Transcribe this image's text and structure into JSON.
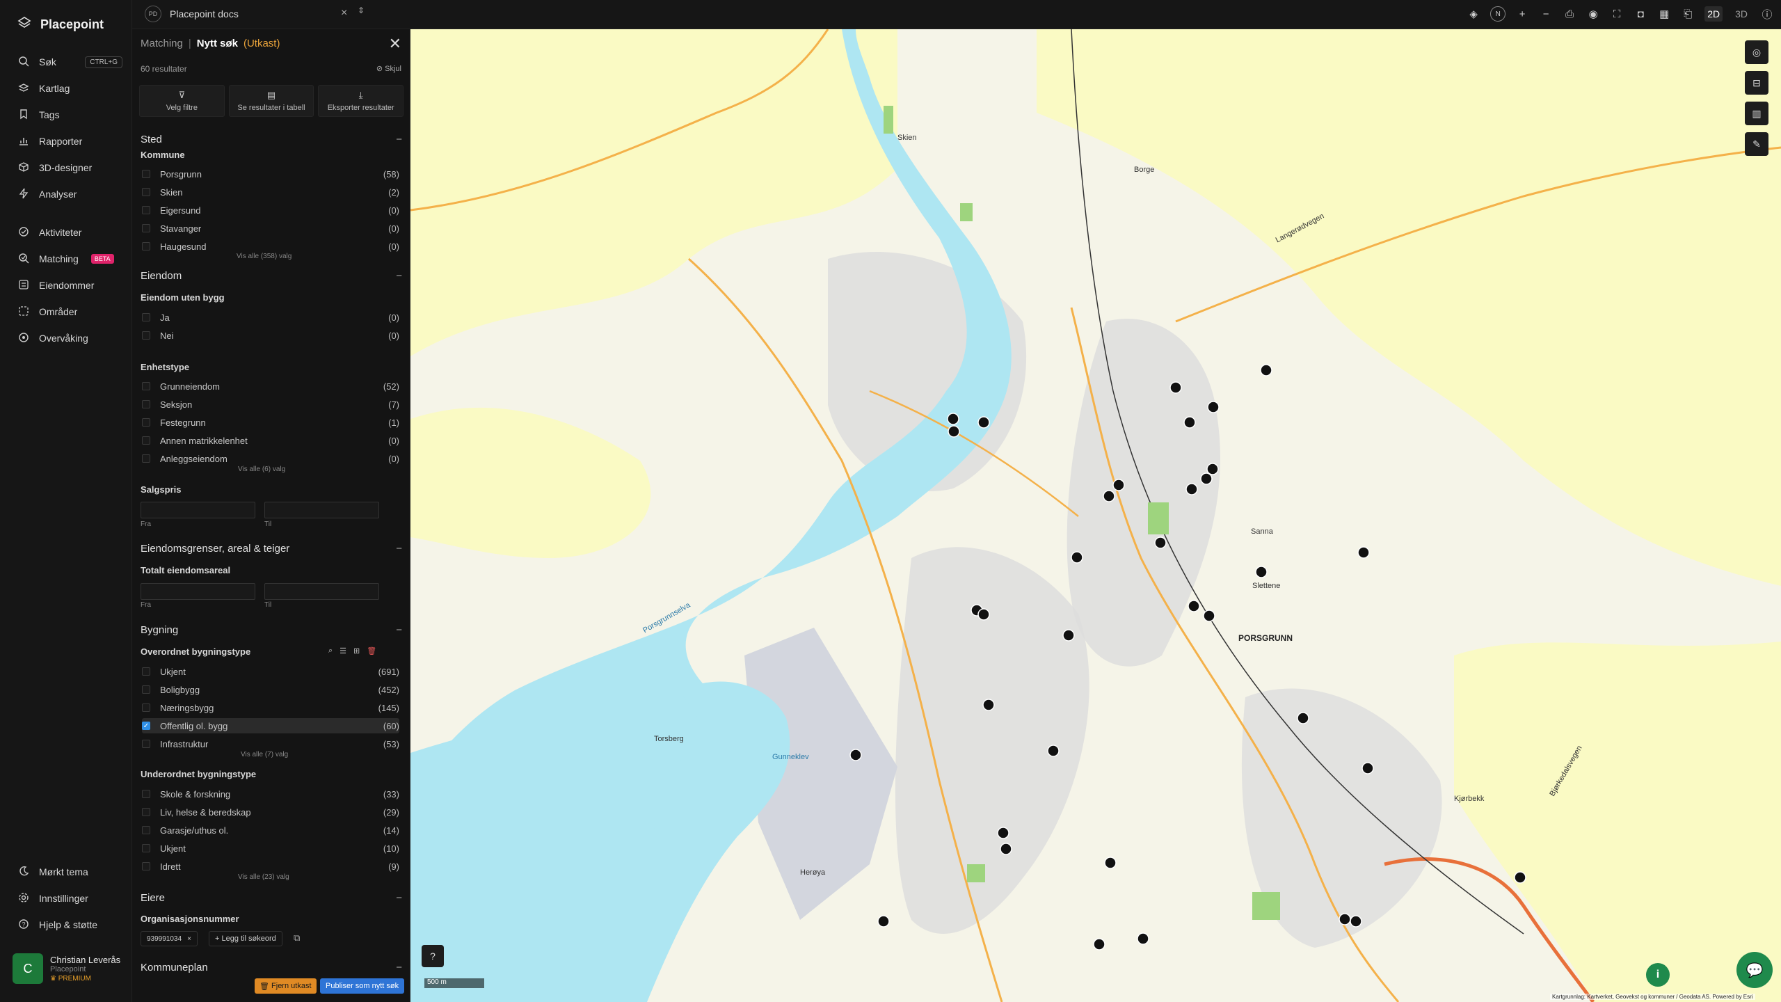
{
  "app": {
    "name": "Placepoint"
  },
  "nav": {
    "items": [
      {
        "label": "Søk",
        "shortcut": "CTRL+G",
        "icon": "search-icon"
      },
      {
        "label": "Kartlag",
        "icon": "layers-icon"
      },
      {
        "label": "Tags",
        "icon": "bookmark-icon"
      },
      {
        "label": "Rapporter",
        "icon": "chart-icon"
      },
      {
        "label": "3D-designer",
        "icon": "cube-icon"
      },
      {
        "label": "Analyser",
        "icon": "bolt-icon"
      },
      {
        "label": "Aktiviteter",
        "icon": "activity-icon"
      },
      {
        "label": "Matching",
        "badge": "BETA",
        "icon": "matching-icon"
      },
      {
        "label": "Eiendommer",
        "icon": "list-icon"
      },
      {
        "label": "Områder",
        "icon": "area-icon"
      },
      {
        "label": "Overvåking",
        "icon": "monitor-icon"
      }
    ],
    "bottom": [
      {
        "label": "Mørkt tema",
        "icon": "moon-icon"
      },
      {
        "label": "Innstillinger",
        "icon": "gear-icon"
      },
      {
        "label": "Hjelp & støtte",
        "icon": "help-icon"
      }
    ]
  },
  "user": {
    "initial": "C",
    "name": "Christian Leverås",
    "org": "Placepoint",
    "plan": "PREMIUM"
  },
  "workspace": {
    "badge": "PD",
    "name": "Placepoint docs"
  },
  "toolbar": {
    "compass": "N",
    "view2d": "2D",
    "view3d": "3D"
  },
  "panel": {
    "crumb": "Matching",
    "title": "Nytt søk",
    "status": "(Utkast)",
    "count": "60 resultater",
    "hide": "Skjul",
    "actions": [
      "Velg filtre",
      "Se resultater i tabell",
      "Eksporter resultater"
    ],
    "sted": {
      "title": "Sted",
      "kommune_label": "Kommune",
      "kommune": [
        {
          "label": "Porsgrunn",
          "count": "(58)"
        },
        {
          "label": "Skien",
          "count": "(2)"
        },
        {
          "label": "Eigersund",
          "count": "(0)"
        },
        {
          "label": "Stavanger",
          "count": "(0)"
        },
        {
          "label": "Haugesund",
          "count": "(0)"
        }
      ],
      "more": "Vis alle (358) valg"
    },
    "eiendom": {
      "title": "Eiendom",
      "uten_bygg_label": "Eiendom uten bygg",
      "uten_bygg": [
        {
          "label": "Ja",
          "count": "(0)"
        },
        {
          "label": "Nei",
          "count": "(0)"
        }
      ],
      "enhetstype_label": "Enhetstype",
      "enhetstype": [
        {
          "label": "Grunneiendom",
          "count": "(52)"
        },
        {
          "label": "Seksjon",
          "count": "(7)"
        },
        {
          "label": "Festegrunn",
          "count": "(1)"
        },
        {
          "label": "Annen matrikkelenhet",
          "count": "(0)"
        },
        {
          "label": "Anleggseiendom",
          "count": "(0)"
        }
      ],
      "more": "Vis alle (6) valg",
      "salgspris_label": "Salgspris",
      "from": "Fra",
      "to": "Til"
    },
    "grenser": {
      "title": "Eiendomsgrenser, areal & teiger",
      "areal_label": "Totalt eiendomsareal",
      "from": "Fra",
      "to": "Til"
    },
    "bygning": {
      "title": "Bygning",
      "overordnet_label": "Overordnet bygningstype",
      "overordnet": [
        {
          "label": "Ukjent",
          "count": "(691)"
        },
        {
          "label": "Boligbygg",
          "count": "(452)"
        },
        {
          "label": "Næringsbygg",
          "count": "(145)"
        },
        {
          "label": "Offentlig ol. bygg",
          "count": "(60)",
          "selected": true
        },
        {
          "label": "Infrastruktur",
          "count": "(53)"
        }
      ],
      "more1": "Vis alle (7) valg",
      "underordnet_label": "Underordnet bygningstype",
      "underordnet": [
        {
          "label": "Skole & forskning",
          "count": "(33)"
        },
        {
          "label": "Liv, helse & beredskap",
          "count": "(29)"
        },
        {
          "label": "Garasje/uthus ol.",
          "count": "(14)"
        },
        {
          "label": "Ukjent",
          "count": "(10)"
        },
        {
          "label": "Idrett",
          "count": "(9)"
        }
      ],
      "more2": "Vis alle (23) valg"
    },
    "eiere": {
      "title": "Eiere",
      "org_label": "Organisasjonsnummer",
      "chip": "939991034",
      "add": "Legg til søkeord"
    },
    "kommuneplan": {
      "title": "Kommuneplan"
    },
    "remove_btn": "Fjern utkast",
    "publish_btn": "Publiser som nytt søk"
  },
  "map": {
    "labels": [
      "PORSGRUNN",
      "Herøya",
      "Torsberg",
      "Porsgrunnselva",
      "Gunneklev",
      "Skien",
      "Borge",
      "Sanna",
      "Slettene",
      "Langerødvegen",
      "Kjørbekk",
      "Bjørkedalsvegen"
    ],
    "scale": "500 m",
    "attribution": "Kartgrunnlag: Kartverket, Geovekst og kommuner / Geodata AS. Powered by Esri",
    "colors": {
      "water": "#aee6f2",
      "forest": "#fafac0",
      "land": "#f2f2ee",
      "urban": "#d9d9d9",
      "marker": "#111111"
    }
  }
}
